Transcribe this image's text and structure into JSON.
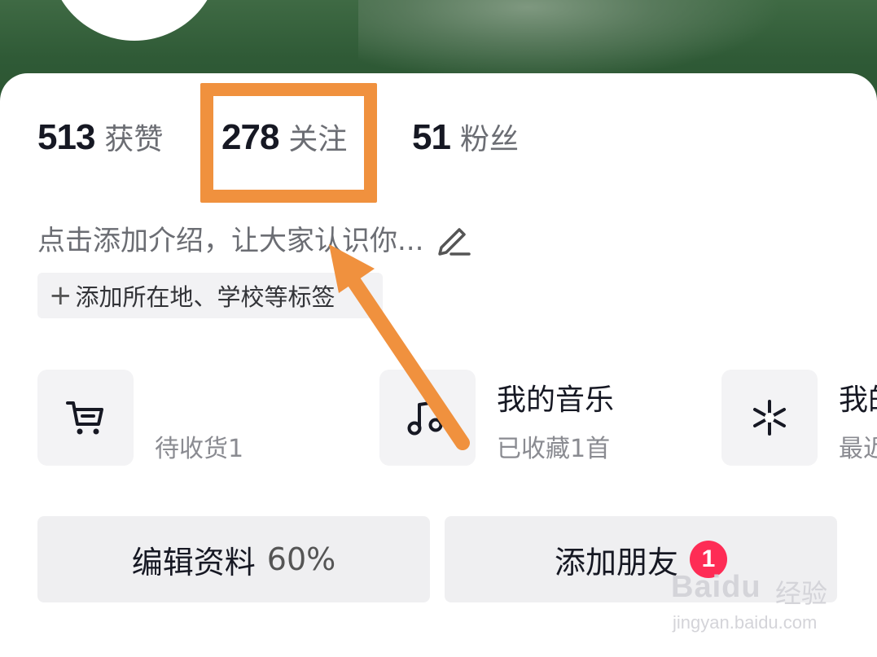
{
  "stats": [
    {
      "value": "513",
      "label": "获赞"
    },
    {
      "value": "278",
      "label": "关注"
    },
    {
      "value": "51",
      "label": "粉丝"
    }
  ],
  "bio": {
    "placeholder": "点击添加介绍，让大家认识你..."
  },
  "tag_chip": {
    "label": "添加所在地、学校等标签"
  },
  "shortcuts": [
    {
      "title": "",
      "subtitle": "待收货1",
      "icon": "cart-icon"
    },
    {
      "title": "我的音乐",
      "subtitle": "已收藏1首",
      "icon": "music-note-icon"
    },
    {
      "title": "我的",
      "subtitle": "最近",
      "icon": "asterisk-icon"
    }
  ],
  "buttons": {
    "edit_profile": {
      "label": "编辑资料",
      "percent": "60%"
    },
    "add_friends": {
      "label": "添加朋友",
      "badge": "1"
    }
  },
  "annotation": {
    "color": "#f0913e"
  },
  "watermark": {
    "brand": "Baidu",
    "cn": "经验",
    "url": "jingyan.baidu.com"
  }
}
